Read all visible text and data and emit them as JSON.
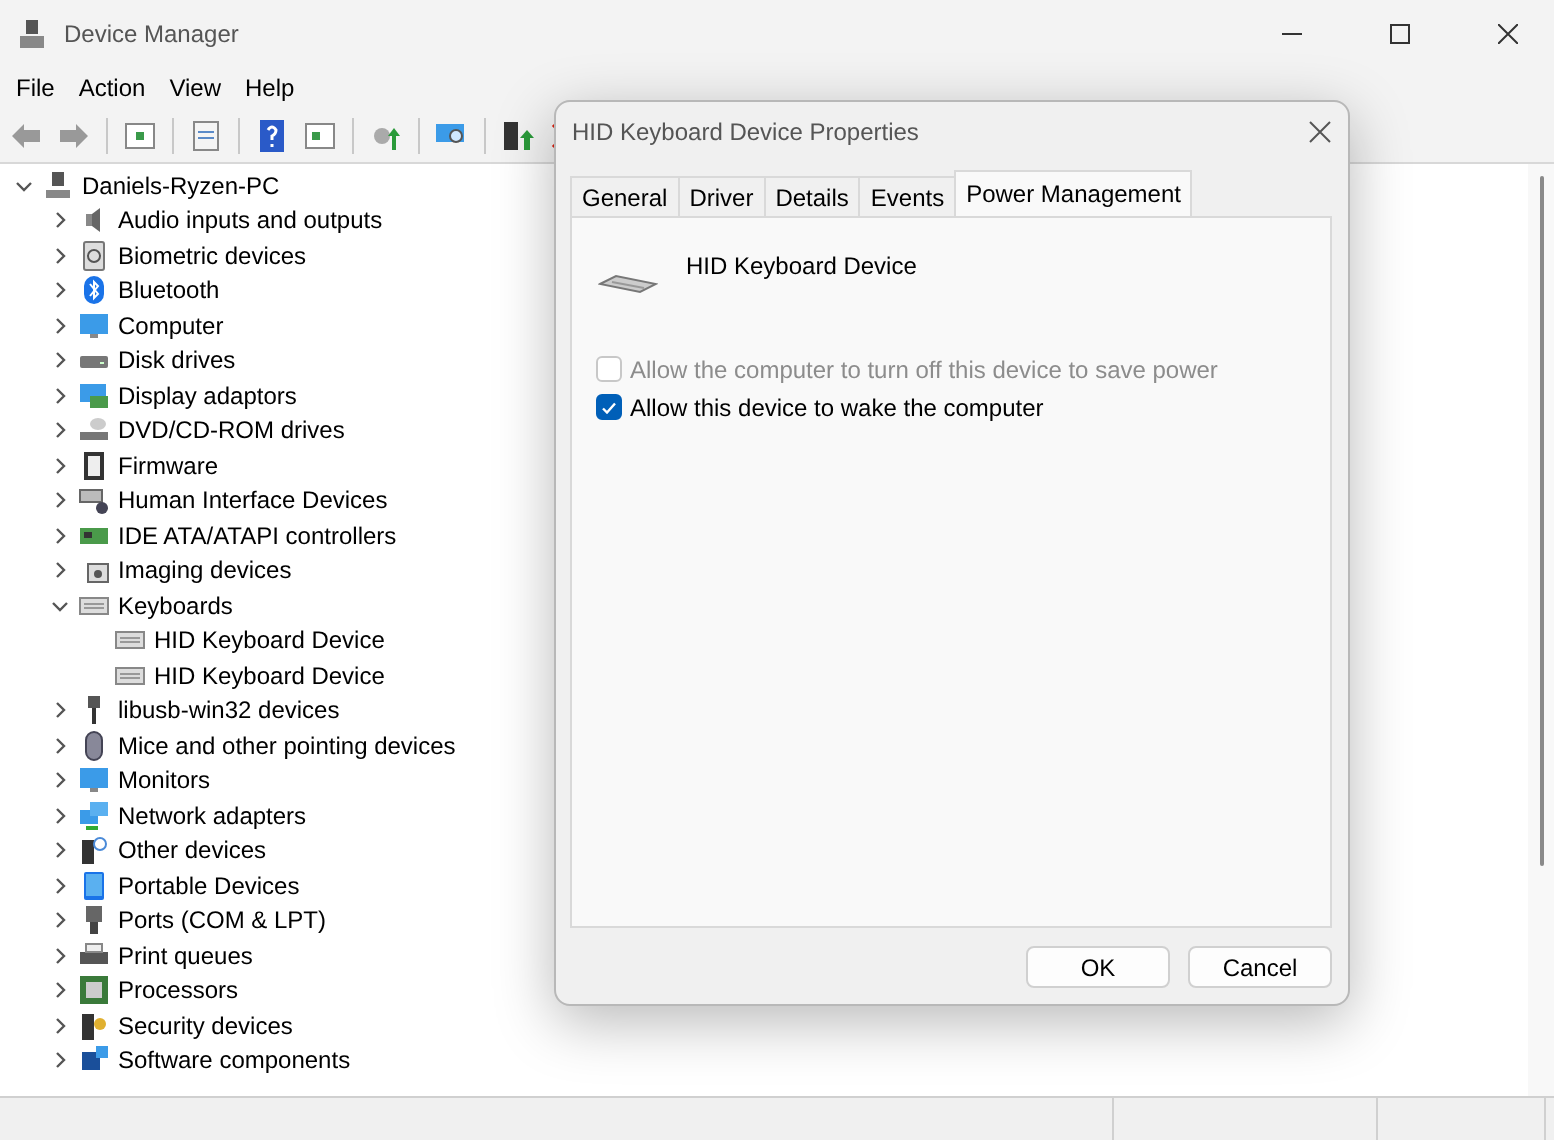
{
  "window": {
    "title": "Device Manager"
  },
  "menu": [
    "File",
    "Action",
    "View",
    "Help"
  ],
  "tree": {
    "label": "Daniels-Ryzen-PC",
    "expanded": true,
    "children": [
      {
        "label": "Audio inputs and outputs",
        "expanded": false
      },
      {
        "label": "Biometric devices",
        "expanded": false
      },
      {
        "label": "Bluetooth",
        "expanded": false
      },
      {
        "label": "Computer",
        "expanded": false
      },
      {
        "label": "Disk drives",
        "expanded": false
      },
      {
        "label": "Display adaptors",
        "expanded": false
      },
      {
        "label": "DVD/CD-ROM drives",
        "expanded": false
      },
      {
        "label": "Firmware",
        "expanded": false
      },
      {
        "label": "Human Interface Devices",
        "expanded": false
      },
      {
        "label": "IDE ATA/ATAPI controllers",
        "expanded": false
      },
      {
        "label": "Imaging devices",
        "expanded": false
      },
      {
        "label": "Keyboards",
        "expanded": true,
        "children": [
          {
            "label": "HID Keyboard Device"
          },
          {
            "label": "HID Keyboard Device"
          }
        ]
      },
      {
        "label": "libusb-win32 devices",
        "expanded": false
      },
      {
        "label": "Mice and other pointing devices",
        "expanded": false
      },
      {
        "label": "Monitors",
        "expanded": false
      },
      {
        "label": "Network adapters",
        "expanded": false
      },
      {
        "label": "Other devices",
        "expanded": false
      },
      {
        "label": "Portable Devices",
        "expanded": false
      },
      {
        "label": "Ports (COM & LPT)",
        "expanded": false
      },
      {
        "label": "Print queues",
        "expanded": false
      },
      {
        "label": "Processors",
        "expanded": false
      },
      {
        "label": "Security devices",
        "expanded": false
      },
      {
        "label": "Software components",
        "expanded": false
      }
    ]
  },
  "dialog": {
    "title": "HID Keyboard Device Properties",
    "tabs": [
      {
        "label": "General",
        "selected": false
      },
      {
        "label": "Driver",
        "selected": false
      },
      {
        "label": "Details",
        "selected": false
      },
      {
        "label": "Events",
        "selected": false
      },
      {
        "label": "Power Management",
        "selected": true
      }
    ],
    "device_name": "HID Keyboard Device",
    "options": [
      {
        "label": "Allow the computer to turn off this device to save power",
        "checked": false,
        "disabled": true
      },
      {
        "label": "Allow this device to wake the computer",
        "checked": true,
        "disabled": false
      }
    ],
    "buttons": [
      "OK",
      "Cancel"
    ]
  }
}
